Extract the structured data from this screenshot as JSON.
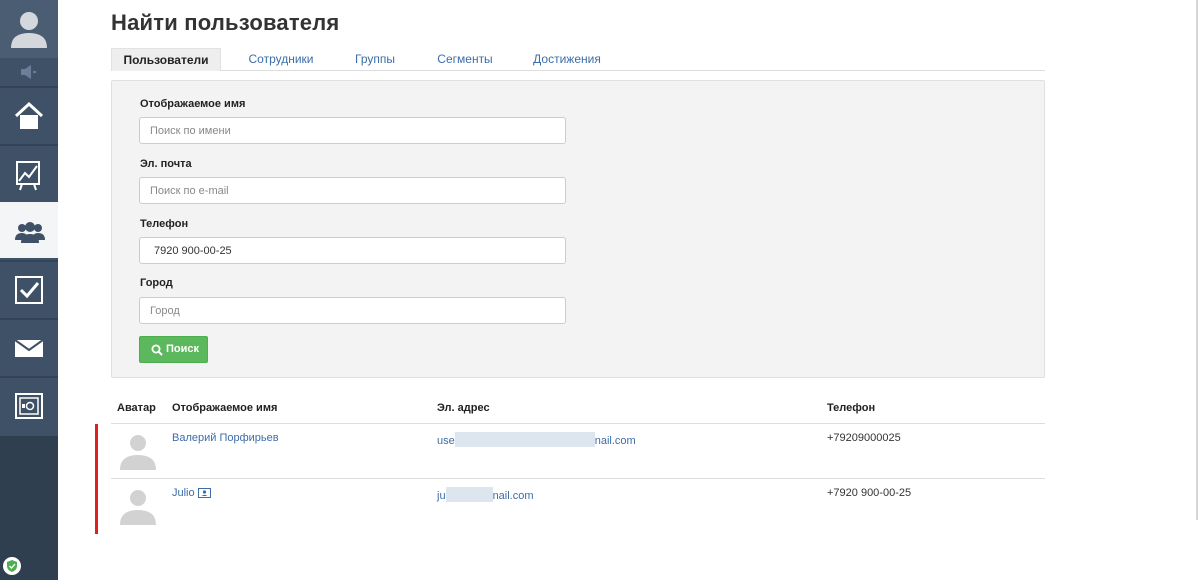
{
  "page_title": "Найти пользователя",
  "tabs": [
    {
      "label": "Пользователи",
      "active": true
    },
    {
      "label": "Сотрудники",
      "active": false
    },
    {
      "label": "Группы",
      "active": false
    },
    {
      "label": "Сегменты",
      "active": false
    },
    {
      "label": "Достижения",
      "active": false
    }
  ],
  "sidebar": {
    "items": [
      {
        "icon": "home-icon",
        "active": false
      },
      {
        "icon": "chart-icon",
        "active": false
      },
      {
        "icon": "users-icon",
        "active": true
      },
      {
        "icon": "checkbox-icon",
        "active": false
      },
      {
        "icon": "mail-icon",
        "active": false
      },
      {
        "icon": "safe-icon",
        "active": false
      }
    ]
  },
  "form": {
    "name_label": "Отображаемое имя",
    "name_placeholder": "Поиск по имени",
    "email_label": "Эл. почта",
    "email_placeholder": "Поиск по e-mail",
    "phone_label": "Телефон",
    "phone_value": "7920 900-00-25",
    "city_label": "Город",
    "city_placeholder": "Город",
    "search_button": "Поиск"
  },
  "table": {
    "headers": {
      "avatar": "Аватар",
      "name": "Отображаемое имя",
      "email": "Эл. адрес",
      "phone": "Телефон"
    },
    "rows": [
      {
        "name": "Валерий Порфирьев",
        "email_start": "use",
        "email_end": "nail.com",
        "phone": "+79209000025"
      },
      {
        "name": "Julio",
        "email_start": "ju",
        "email_end": "nail.com",
        "phone": "+7920 900-00-25"
      }
    ]
  },
  "colors": {
    "sidebar": "#3e5166",
    "link": "#3c6da8",
    "search_button": "#5cb85c",
    "marker": "#e02020"
  }
}
